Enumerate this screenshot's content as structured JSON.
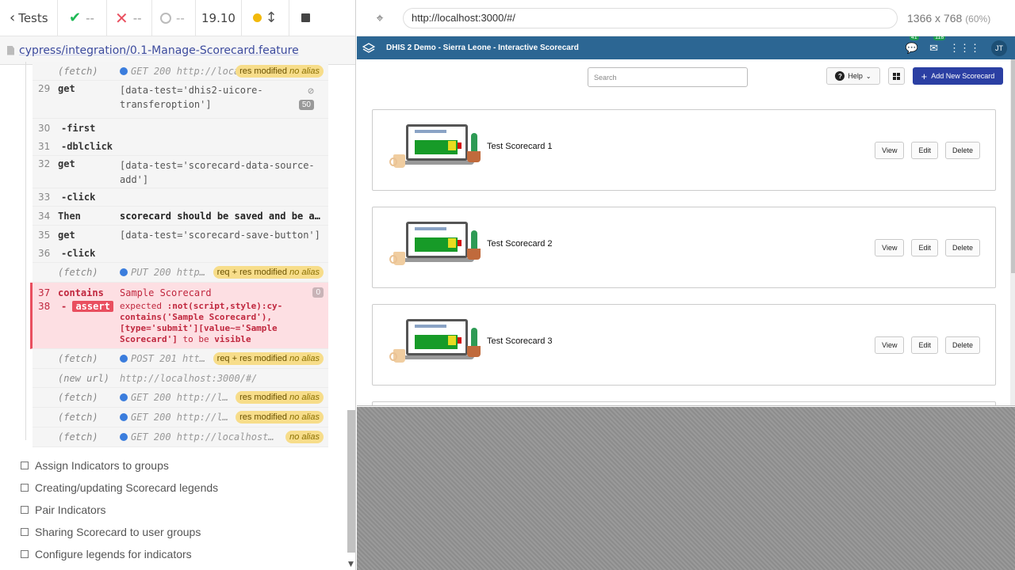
{
  "reporter": {
    "tests_label": "Tests",
    "passed": "--",
    "failed": "--",
    "pending": "--",
    "duration": "19.10",
    "spec_path": "cypress/integration/0.1-Manage-Scorecard.feature"
  },
  "commands": [
    {
      "num": "",
      "name": "(fetch)",
      "msg": "GET 200 http://loca…",
      "pill": "res modified",
      "alias": "no alias",
      "type": "fetch"
    },
    {
      "num": "29",
      "name": "get",
      "msg": "[data-test='dhis2-uicore-transferoption']",
      "count": "50",
      "type": "get"
    },
    {
      "num": "30",
      "name": "-first",
      "msg": "",
      "type": "sub"
    },
    {
      "num": "31",
      "name": "-dblclick",
      "msg": "",
      "type": "sub"
    },
    {
      "num": "32",
      "name": "get",
      "msg": "[data-test='scorecard-data-source-add']",
      "type": "get"
    },
    {
      "num": "33",
      "name": "-click",
      "msg": "",
      "type": "sub"
    },
    {
      "num": "34",
      "name": "Then",
      "msg": "scorecard should be saved and be a…",
      "type": "then"
    },
    {
      "num": "35",
      "name": "get",
      "msg": "[data-test='scorecard-save-button']",
      "type": "get"
    },
    {
      "num": "36",
      "name": "-click",
      "msg": "",
      "type": "sub"
    },
    {
      "num": "",
      "name": "(fetch)",
      "msg": "PUT 200 http…",
      "pill": "req + res modified",
      "alias": "no alias",
      "type": "fetch"
    }
  ],
  "failed_cmd": {
    "num1": "37",
    "name1": "contains",
    "msg1": "Sample Scorecard",
    "count1": "0",
    "num2": "38",
    "name2": "assert",
    "expect_pre": "expected",
    "selector": ":not(script,style):cy-contains('Sample Scorecard'), [type='submit'][value~='Sample Scorecard']",
    "to_be": "to be",
    "visible": "visible"
  },
  "commands_after": [
    {
      "name": "(fetch)",
      "msg": "POST 201 htt…",
      "pill": "req + res modified",
      "alias": "no alias",
      "type": "fetch"
    },
    {
      "name": "(new url)",
      "msg": "http://localhost:3000/#/",
      "type": "newurl"
    },
    {
      "name": "(fetch)",
      "msg": "GET 200 http://l…",
      "pill": "res modified",
      "alias": "no alias",
      "type": "fetch"
    },
    {
      "name": "(fetch)",
      "msg": "GET 200 http://l…",
      "pill": "res modified",
      "alias": "no alias",
      "type": "fetch"
    },
    {
      "name": "(fetch)",
      "msg": "GET 200 http://localhost…",
      "pill": "",
      "alias": "no alias",
      "type": "fetch"
    }
  ],
  "suites": [
    "Assign Indicators to groups",
    "Creating/updating Scorecard legends",
    "Pair Indicators",
    "Sharing Scorecard to user groups",
    "Configure legends for indicators"
  ],
  "browser": {
    "url": "http://localhost:3000/#/",
    "viewport": "1366 x 768",
    "scale": "(60%)"
  },
  "app": {
    "title": "DHIS 2 Demo - Sierra Leone - Interactive Scorecard",
    "interpretations_count": "41",
    "messages_count": "118",
    "user_initials": "JT",
    "search_placeholder": "Search",
    "help_label": "Help",
    "add_label": "Add New Scorecard",
    "view_label": "View",
    "edit_label": "Edit",
    "delete_label": "Delete",
    "scorecards": [
      "Test Scorecard 1",
      "Test Scorecard 2",
      "Test Scorecard 3"
    ]
  }
}
